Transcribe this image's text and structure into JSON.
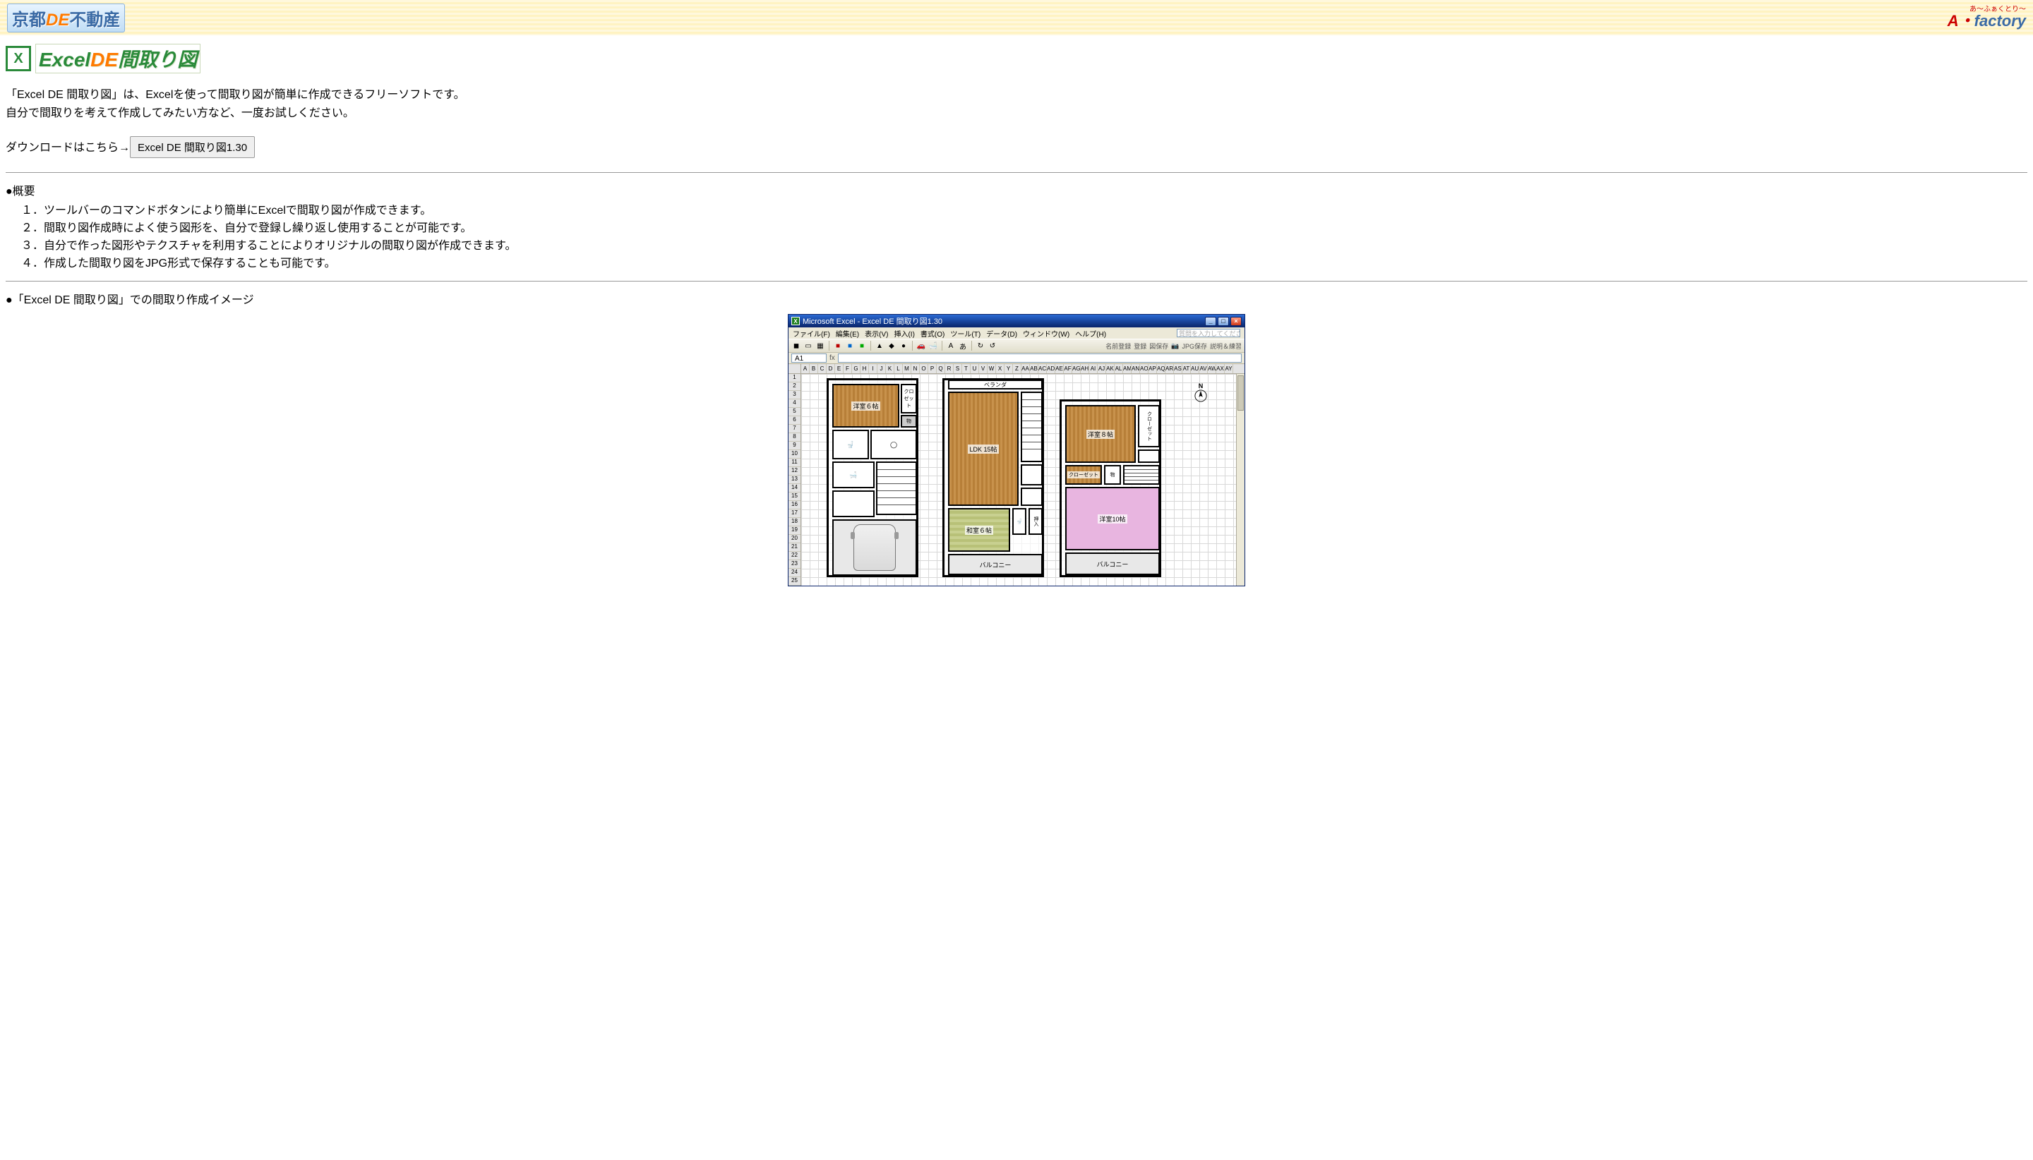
{
  "header": {
    "logo_left": {
      "part1": "京都",
      "part_de": "DE",
      "part2": "不動産"
    },
    "logo_right": {
      "ruby": "あ～ふぁくとり～",
      "a": "A",
      "dot": "・",
      "rest": "factory"
    }
  },
  "page_title": {
    "icon_text": "X",
    "excel": "Excel",
    "de": "DE",
    "jp": "間取り図"
  },
  "intro": {
    "line1": "「Excel DE 間取り図」は、Excelを使って間取り図が簡単に作成できるフリーソフトです。",
    "line2": "自分で間取りを考えて作成してみたい方など、一度お試しください。"
  },
  "download": {
    "label": "ダウンロードはこちら→",
    "button": "Excel DE 間取り図1.30"
  },
  "overview": {
    "heading": "●概要",
    "items": [
      "１．ツールバーのコマンドボタンにより簡単にExcelで間取り図が作成できます。",
      "２．間取り図作成時によく使う図形を、自分で登録し繰り返し使用することが可能です。",
      "３．自分で作った図形やテクスチャを利用することによりオリジナルの間取り図が作成できます。",
      "４．作成した間取り図をJPG形式で保存することも可能です。"
    ]
  },
  "image_section_head": "●「Excel DE 間取り図」での間取り作成イメージ",
  "shot": {
    "title": "Microsoft Excel - Excel DE 間取り図1.30",
    "winbtn_min": "_",
    "winbtn_max": "□",
    "winbtn_close": "×",
    "menus": [
      "ファイル(F)",
      "編集(E)",
      "表示(V)",
      "挿入(I)",
      "書式(O)",
      "ツール(T)",
      "データ(D)",
      "ウィンドウ(W)",
      "ヘルプ(H)"
    ],
    "ask_placeholder": "質問を入力してください",
    "right_tools": [
      "名前登録",
      "登録",
      "図保存",
      "JPG保存",
      "説明＆練習"
    ],
    "namebox": "A1",
    "fx": "fx",
    "cols": [
      "A",
      "B",
      "C",
      "D",
      "E",
      "F",
      "G",
      "H",
      "I",
      "J",
      "K",
      "L",
      "M",
      "N",
      "O",
      "P",
      "Q",
      "R",
      "S",
      "T",
      "U",
      "V",
      "W",
      "X",
      "Y",
      "Z",
      "AA",
      "AB",
      "AC",
      "AD",
      "AE",
      "AF",
      "AG",
      "AH",
      "AI",
      "AJ",
      "AK",
      "AL",
      "AM",
      "AN",
      "AO",
      "AP",
      "AQ",
      "AR",
      "AS",
      "AT",
      "AU",
      "AV",
      "AW",
      "AX",
      "AY"
    ],
    "rows": [
      "1",
      "2",
      "3",
      "4",
      "5",
      "6",
      "7",
      "8",
      "9",
      "10",
      "11",
      "12",
      "13",
      "14",
      "15",
      "16",
      "17",
      "18",
      "19",
      "20",
      "21",
      "22",
      "23",
      "24",
      "25"
    ],
    "compass": "N",
    "b1": {
      "r1": "洋室６帖",
      "closet": "クロゼット",
      "thing": "物"
    },
    "b2": {
      "veranda": "ベランダ",
      "ldk": "LDK 15帖",
      "wa": "和室６帖",
      "osi": "押入",
      "bal": "バルコニー"
    },
    "b3": {
      "r1": "洋室８帖",
      "closet": "クローゼット",
      "mid1": "クローゼット",
      "mid2": "物",
      "r2": "洋室10帖",
      "bal": "バルコニー"
    }
  }
}
